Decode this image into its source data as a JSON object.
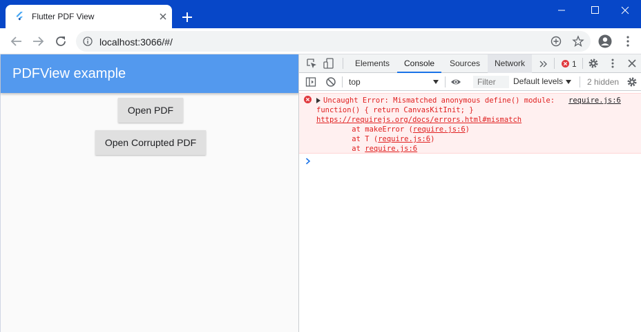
{
  "browser": {
    "tab_title": "Flutter PDF View",
    "url": "localhost:3066/#/"
  },
  "app": {
    "title": "PDFView example",
    "buttons": {
      "open_pdf": "Open PDF",
      "open_corrupted_pdf": "Open Corrupted PDF"
    },
    "colors": {
      "appbar": "#5399ee",
      "button": "#e0e0e0",
      "background": "#fafafa"
    }
  },
  "devtools": {
    "tabs": [
      "Elements",
      "Console",
      "Sources",
      "Network"
    ],
    "active_tab": "Console",
    "error_count": "1",
    "context": "top",
    "filter_placeholder": "Filter",
    "levels": "Default levels",
    "hidden": "2 hidden",
    "console": {
      "error_line1": "Uncaught Error: Mismatched anonymous define() module: ",
      "error_source": "require.js:6",
      "error_line2": "function() { return CanvasKitInit; }",
      "error_link": "https://requirejs.org/docs/errors.html#mismatch",
      "stack": [
        {
          "prefix": "    at makeError (",
          "link": "require.js:6",
          "suffix": ")"
        },
        {
          "prefix": "    at T (",
          "link": "require.js:6",
          "suffix": ")"
        },
        {
          "prefix": "    at ",
          "link": "require.js:6",
          "suffix": ""
        }
      ]
    }
  }
}
